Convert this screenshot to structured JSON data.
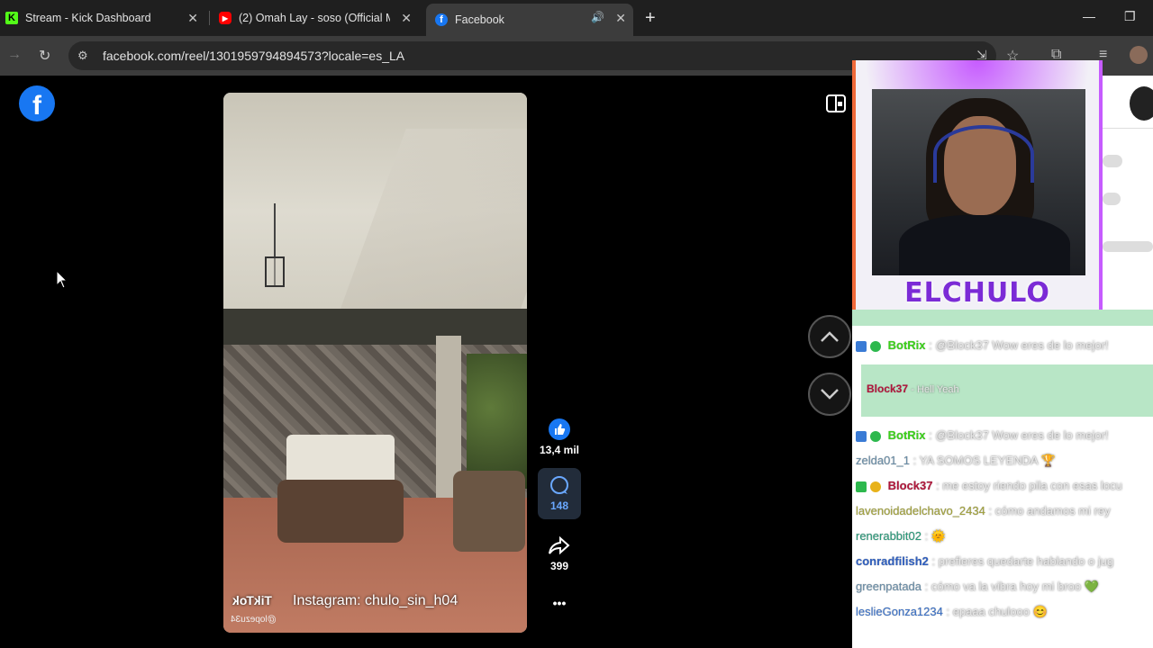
{
  "browser": {
    "tabs": [
      {
        "label": "Stream - Kick Dashboard",
        "icon": "kick-icon",
        "active": false
      },
      {
        "label": "(2) Omah Lay - soso (Official M",
        "icon": "youtube-icon",
        "active": false
      },
      {
        "label": "Facebook",
        "icon": "facebook-icon",
        "active": true
      }
    ],
    "url": "facebook.com/reel/1301959794894573?locale=es_LA"
  },
  "reel": {
    "overlay_caption": "Instagram: chulo_sin_h04",
    "watermark": "TikTok",
    "watermark_user": "@lopezu34",
    "likes": "13,4 mil",
    "comments": "148",
    "shares": "399",
    "more": "•••"
  },
  "stream": {
    "brand_name": "ELCHULO"
  },
  "chat": [
    {
      "user": "BotRix",
      "text": ": @Block37 Wow eres de lo mejor!",
      "user_color": "#3bd11a"
    },
    {
      "user": "Block37",
      "text": "- Hell Yeah",
      "user_color": "#b0163a"
    },
    {
      "user": "BotRix",
      "text": ": @Block37 Wow eres de lo mejor!",
      "user_color": "#3bd11a"
    },
    {
      "user": "zelda01_1",
      "text": ": YA SOMOS LEYENDA 🏆",
      "user_color": "#6a8ea8"
    },
    {
      "user": "Block37",
      "text": ": me estoy riendo pila con esas locu",
      "user_color": "#b0163a"
    },
    {
      "user": "lavenoidadelchavo_2434",
      "text": ": cómo andamos mi rey",
      "user_color": "#a2a23a"
    },
    {
      "user": "renerabbit02",
      "text": ": 🌞",
      "user_color": "#2a9a7a"
    },
    {
      "user": "conradfilish2",
      "text": ": prefieres quedarte hablando o jug",
      "user_color": "#2f5fbf"
    },
    {
      "user": "greenpatada",
      "text": ": cómo va la vibra hoy mi broo 💚",
      "user_color": "#6a8ea8"
    },
    {
      "user": "leslieGonza1234",
      "text": ": epaaa chulooo 😊",
      "user_color": "#3b72c9"
    }
  ],
  "colors": {
    "facebook_blue": "#1877f2",
    "chat_highlight": "#b8e6c6",
    "brand": "#7b2bd6"
  }
}
